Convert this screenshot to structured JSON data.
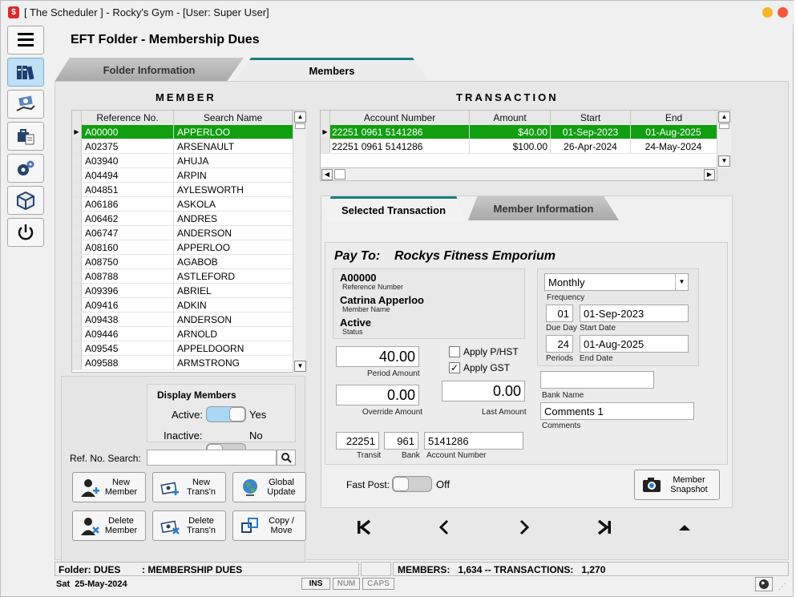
{
  "window": {
    "title": "[ The Scheduler ] - Rocky's Gym - [User: Super User]",
    "app_icon": "$"
  },
  "page_title": "EFT Folder - Membership Dues",
  "tabs": [
    {
      "label": "Folder Information"
    },
    {
      "label": "Members"
    }
  ],
  "member": {
    "heading": "MEMBER",
    "columns": [
      "Reference No.",
      "Search Name"
    ],
    "rows": [
      [
        "A00000",
        "APPERLOO"
      ],
      [
        "A02375",
        "ARSENAULT"
      ],
      [
        "A03940",
        "AHUJA"
      ],
      [
        "A04494",
        "ARPIN"
      ],
      [
        "A04851",
        "AYLESWORTH"
      ],
      [
        "A06186",
        "ASKOLA"
      ],
      [
        "A06462",
        "ANDRES"
      ],
      [
        "A06747",
        "ANDERSON"
      ],
      [
        "A08160",
        "APPERLOO"
      ],
      [
        "A08750",
        "AGABOB"
      ],
      [
        "A08788",
        "ASTLEFORD"
      ],
      [
        "A09396",
        "ABRIEL"
      ],
      [
        "A09416",
        "ADKIN"
      ],
      [
        "A09438",
        "ANDERSON"
      ],
      [
        "A09446",
        "ARNOLD"
      ],
      [
        "A09545",
        "APPELDOORN"
      ],
      [
        "A09588",
        "ARMSTRONG"
      ]
    ]
  },
  "display_members": {
    "title": "Display Members",
    "active_label": "Active:",
    "active_value": "Yes",
    "inactive_label": "Inactive:",
    "inactive_value": "No"
  },
  "ref_search": {
    "label": "Ref. No. Search:",
    "value": ""
  },
  "buttons": {
    "new_member": "New\nMember",
    "new_trans": "New\nTrans'n",
    "global_update": "Global\nUpdate",
    "delete_member": "Delete\nMember",
    "delete_trans": "Delete\nTrans'n",
    "copy_move": "Copy /\nMove",
    "member_snapshot": "Member\nSnapshot"
  },
  "transaction": {
    "heading": "TRANSACTION",
    "columns": [
      "Account Number",
      "Amount",
      "Start",
      "End"
    ],
    "rows": [
      [
        "22251 0961 5141286",
        "$40.00",
        "01-Sep-2023",
        "01-Aug-2025"
      ],
      [
        "22251 0961 5141286",
        "$100.00",
        "26-Apr-2024",
        "24-May-2024"
      ]
    ]
  },
  "sub_tabs": [
    {
      "label": "Selected Transaction"
    },
    {
      "label": "Member Information"
    }
  ],
  "detail": {
    "pay_to_label": "Pay To:",
    "pay_to_value": "Rockys Fitness Emporium",
    "ref_number": "A00000",
    "ref_number_label": "Reference Number",
    "member_name": "Catrina Apperloo",
    "member_name_label": "Member Name",
    "status": "Active",
    "status_label": "Status",
    "frequency": "Monthly",
    "frequency_label": "Frequency",
    "due_day": "01",
    "due_day_label": "Due Day",
    "start_date": "01-Sep-2023",
    "start_date_label": "Start Date",
    "periods": "24",
    "periods_label": "Periods",
    "end_date": "01-Aug-2025",
    "end_date_label": "End Date",
    "period_amount": "40.00",
    "period_amount_label": "Period Amount",
    "override_amount": "0.00",
    "override_amount_label": "Override Amount",
    "last_amount": "0.00",
    "last_amount_label": "Last Amount",
    "apply_pst_label": "Apply P/HST",
    "apply_pst_checked": false,
    "apply_gst_label": "Apply GST",
    "apply_gst_checked": true,
    "bank_name": "",
    "bank_name_label": "Bank Name",
    "comments": "Comments 1",
    "comments_label": "Comments",
    "transit": "22251",
    "transit_label": "Transit",
    "bank": "961",
    "bank_label": "Bank",
    "account_number": "5141286",
    "account_number_label": "Account Number"
  },
  "fast_post": {
    "label": "Fast Post:",
    "value": "Off"
  },
  "status_bar": {
    "folder": "Folder: DUES",
    "folder_desc": ": MEMBERSHIP DUES",
    "counts": "MEMBERS:   1,634 -- TRANSACTIONS:   1,270",
    "date": "Sat  25-May-2024",
    "keys": [
      "INS",
      "NUM",
      "CAPS"
    ]
  },
  "colors": {
    "selected_row": "#119e11",
    "toggle_on": "#a9d8f5",
    "toggle_off": "#cfcfcf",
    "tab_accent": "#1a7f7f"
  }
}
